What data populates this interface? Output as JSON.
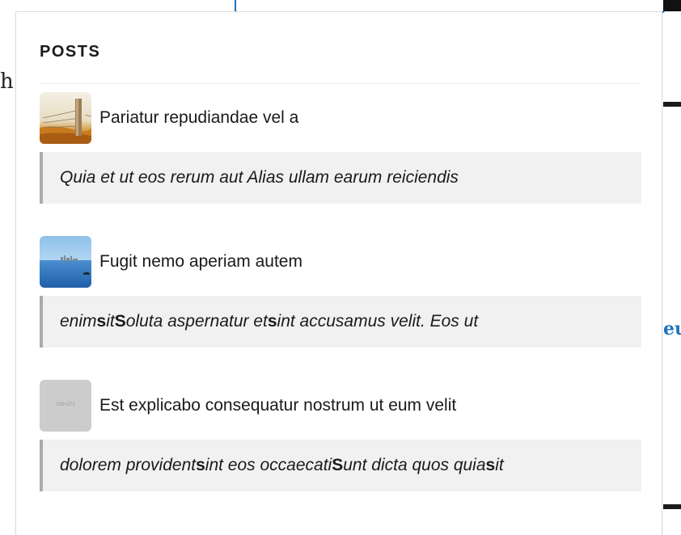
{
  "background": {
    "heading_fragment": "h",
    "link_fragment": "eu"
  },
  "posts_section": {
    "title": "POSTS",
    "items": [
      {
        "title": "Pariatur repudiandae vel a",
        "thumbnail": "fence-post-icon",
        "excerpt": [
          {
            "text": "Quia et ut eos rerum aut Alias ullam earum reiciendis",
            "bold": false
          }
        ]
      },
      {
        "title": "Fugit nemo aperiam autem",
        "thumbnail": "sea-skyline-icon",
        "excerpt": [
          {
            "text": "enim ",
            "bold": false
          },
          {
            "text": "s",
            "bold": true
          },
          {
            "text": "it ",
            "bold": false
          },
          {
            "text": "S",
            "bold": true
          },
          {
            "text": "oluta aspernatur et ",
            "bold": false
          },
          {
            "text": "s",
            "bold": true
          },
          {
            "text": "int accusamus velit. Eos ut",
            "bold": false
          }
        ]
      },
      {
        "title": "Est explicabo consequatur nostrum ut eum velit",
        "thumbnail": "placeholder-image-icon",
        "thumbnail_label": "339×271",
        "excerpt": [
          {
            "text": "dolorem provident ",
            "bold": false
          },
          {
            "text": "s",
            "bold": true
          },
          {
            "text": "int eos occaecati ",
            "bold": false
          },
          {
            "text": "S",
            "bold": true
          },
          {
            "text": "unt dicta quos quia ",
            "bold": false
          },
          {
            "text": "s",
            "bold": true
          },
          {
            "text": "it",
            "bold": false
          }
        ]
      }
    ]
  },
  "colors": {
    "accent": "#1e73be",
    "excerpt_bg": "#f1f1f1",
    "excerpt_border": "#aaaaaa"
  }
}
